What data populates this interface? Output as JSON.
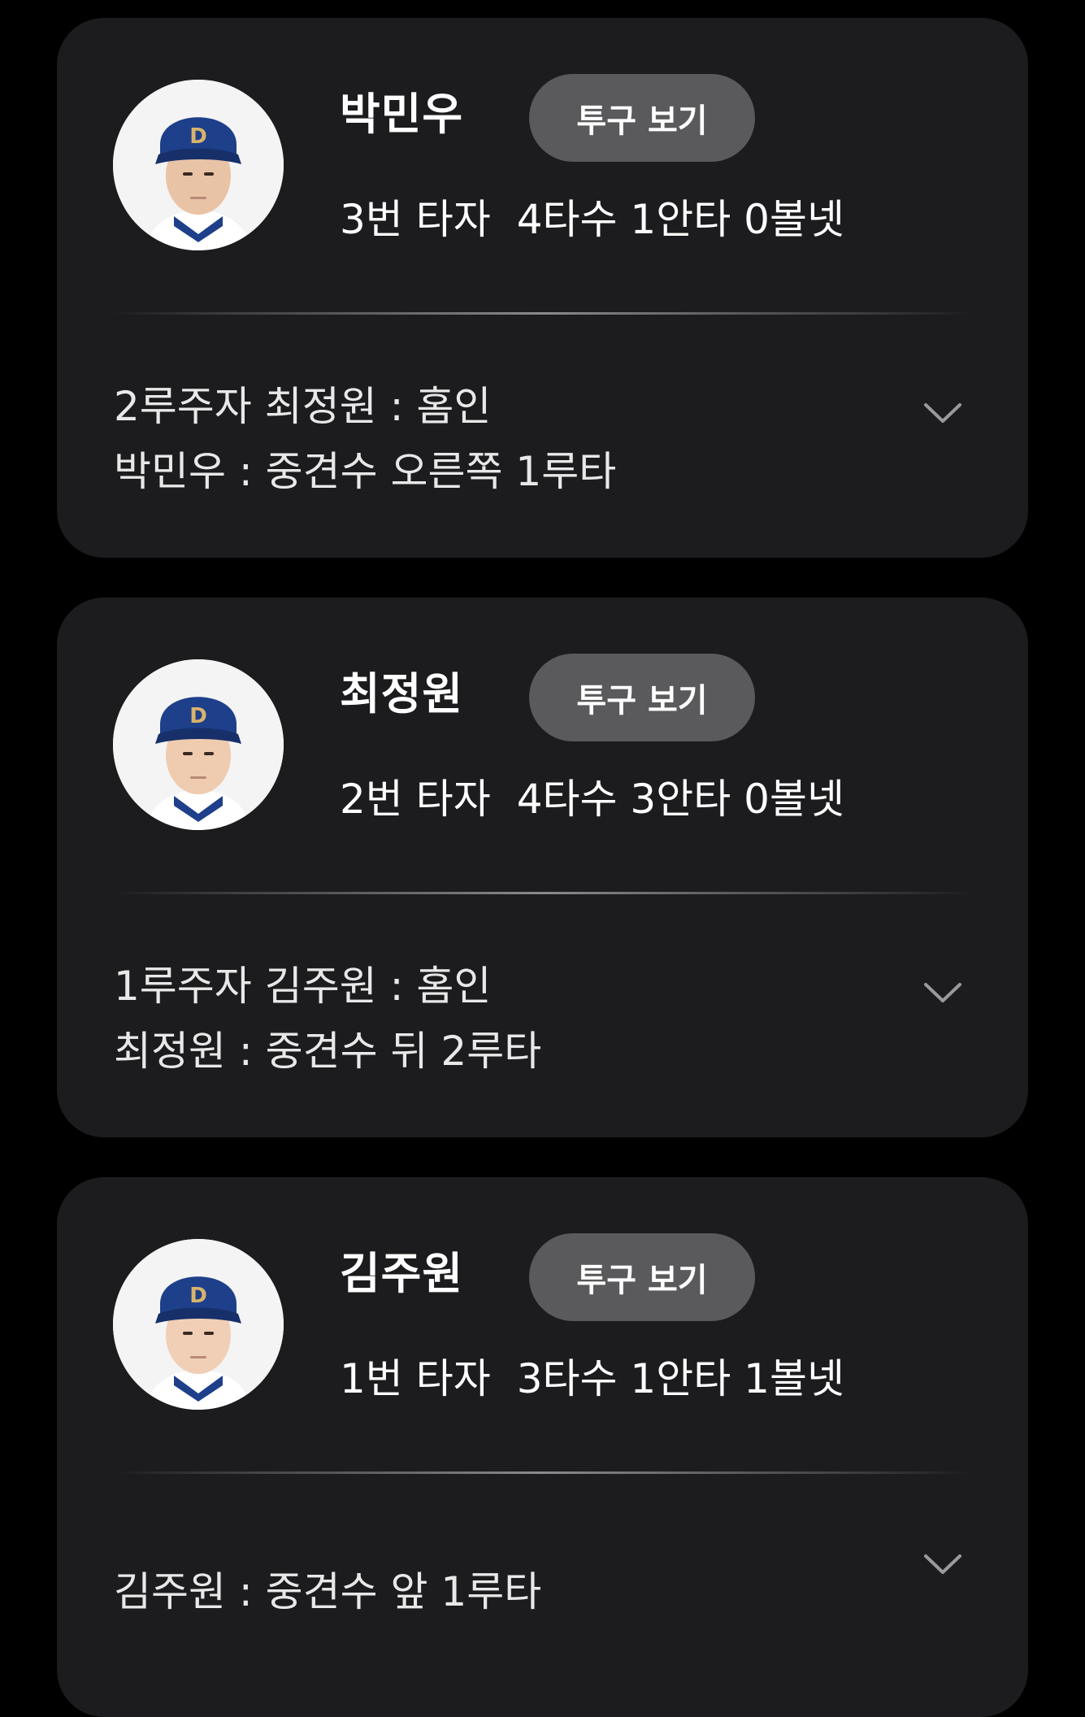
{
  "players": [
    {
      "name": "박민우",
      "pitch_button": "투구 보기",
      "order": "3번 타자",
      "record": "4타수 1안타 0볼넷",
      "events": [
        "2루주자 최정원 : 홈인",
        "박민우 : 중견수 오른쪽 1루타"
      ],
      "expand_icon": "chevron-down-icon"
    },
    {
      "name": "최정원",
      "pitch_button": "투구 보기",
      "order": "2번 타자",
      "record": "4타수 3안타 0볼넷",
      "events": [
        "1루주자 김주원 : 홈인",
        "최정원 : 중견수 뒤 2루타"
      ],
      "expand_icon": "chevron-down-icon"
    },
    {
      "name": "김주원",
      "pitch_button": "투구 보기",
      "order": "1번 타자",
      "record": "3타수 1안타 1볼넷",
      "events": [
        "김주원 : 중견수 앞 1루타"
      ],
      "expand_icon": "chevron-down-icon"
    }
  ],
  "colors": {
    "background": "#000000",
    "card": "#1c1c1e",
    "button": "#5a5a5c",
    "cap": "#1e3f8a",
    "text": "#ffffff"
  }
}
